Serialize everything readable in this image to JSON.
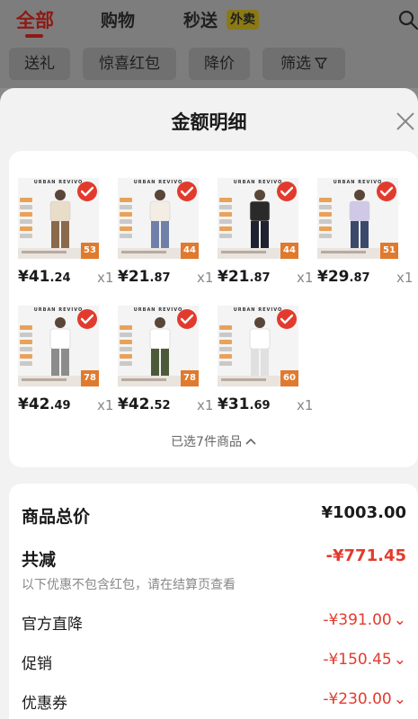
{
  "top_tabs": [
    {
      "label": "全部"
    },
    {
      "label": "购物"
    },
    {
      "label": "秒送"
    }
  ],
  "waimai_badge": "外卖",
  "filters": [
    {
      "label": "送礼"
    },
    {
      "label": "惊喜红包"
    },
    {
      "label": "降价"
    },
    {
      "label": "筛选"
    }
  ],
  "sheet": {
    "title": "金额明细",
    "brand_text": "URBAN REVIVO",
    "items": [
      {
        "price_int": "¥41",
        "price_dec": ".24",
        "qty": "x1",
        "tag": "53"
      },
      {
        "price_int": "¥21",
        "price_dec": ".87",
        "qty": "x1",
        "tag": "44"
      },
      {
        "price_int": "¥21",
        "price_dec": ".87",
        "qty": "x1",
        "tag": "44"
      },
      {
        "price_int": "¥29",
        "price_dec": ".87",
        "qty": "x1",
        "tag": "51"
      },
      {
        "price_int": "¥42",
        "price_dec": ".49",
        "qty": "x1",
        "tag": "78"
      },
      {
        "price_int": "¥42",
        "price_dec": ".52",
        "qty": "x1",
        "tag": "78"
      },
      {
        "price_int": "¥31",
        "price_dec": ".69",
        "qty": "x1",
        "tag": "60"
      }
    ],
    "selected_text": "已选7件商品"
  },
  "summary": {
    "total_label": "商品总价",
    "total_value": "¥1003.00",
    "reduce_label": "共减",
    "reduce_value": "-¥771.45",
    "note": "以下优惠不包含红包，请在结算页查看",
    "lines": [
      {
        "label": "官方直降",
        "value": "-¥391.00"
      },
      {
        "label": "促销",
        "value": "-¥150.45"
      },
      {
        "label": "优惠券",
        "value": "-¥230.00"
      }
    ]
  },
  "colors": {
    "accent_red": "#e23b2e",
    "tab_active": "#8e1a14",
    "tag_orange": "#e07a2e"
  },
  "icons": {
    "search": "search-icon",
    "filter": "funnel-icon",
    "close": "close-icon",
    "check": "checkmark-icon",
    "collapse": "chevron-up-icon",
    "expand": "chevron-down-icon"
  }
}
